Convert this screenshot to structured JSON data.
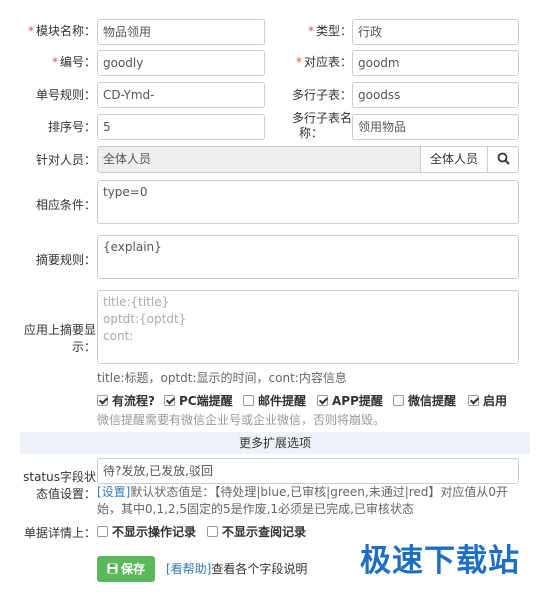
{
  "fields": {
    "module_name": {
      "label": "模块名称：",
      "value": "物品领用"
    },
    "type": {
      "label": "类型：",
      "value": "行政"
    },
    "code": {
      "label": "编号：",
      "value": "goodly"
    },
    "table": {
      "label": "对应表：",
      "value": "goodm"
    },
    "number_rule": {
      "label": "单号规则：",
      "value": "CD-Ymd-"
    },
    "multi_subtable": {
      "label": "多行子表：",
      "value": "goodss"
    },
    "sort_no": {
      "label": "排序号：",
      "value": "5"
    },
    "multi_subtable_name": {
      "label_line1": "多行子表名",
      "label_line2": "称：",
      "value": "领用物品"
    },
    "target_people": {
      "label": "针对人员：",
      "value": "全体人员",
      "button": "全体人员"
    },
    "condition": {
      "label": "相应条件：",
      "value": "type=0"
    },
    "summary_rule": {
      "label": "摘要规则：",
      "value": "{explain}"
    },
    "app_summary": {
      "label_line1": "应用上摘要显",
      "label_line2": "示：",
      "placeholder": [
        "title:{title}",
        "optdt:{optdt}",
        "cont:"
      ],
      "hint": "title:标题，optdt:显示的时间，cont:内容信息"
    }
  },
  "options": [
    {
      "label": "有流程?",
      "checked": true
    },
    {
      "label": "PC端提醒",
      "checked": true
    },
    {
      "label": "邮件提醒",
      "checked": false
    },
    {
      "label": "APP提醒",
      "checked": true
    },
    {
      "label": "微信提醒",
      "checked": false
    },
    {
      "label": "启用",
      "checked": true
    }
  ],
  "wechat_hint": "微信提醒需要有微信企业号或企业微信，否则将崩毁。",
  "more_section": "更多扩展选项",
  "status": {
    "label_line1": "status字段状",
    "label_line2": "态值设置：",
    "value": "待?发放,已发放,驳回",
    "hint_link": "[设置]",
    "hint_line1": "默认状态值是：【待处理|blue,已审核|green,未通过|red】对应值从0开",
    "hint_line2": "始，其中0,1,2,5固定的5是作废,1必须是已完成,已审核状态"
  },
  "detail": {
    "label": "单据详情上：",
    "opt1": "不显示操作记录",
    "opt2": "不显示查阅记录"
  },
  "save_button": "保存",
  "help_link": "[看帮助]",
  "help_text": "查看各个字段说明",
  "watermark": "极速下载站"
}
